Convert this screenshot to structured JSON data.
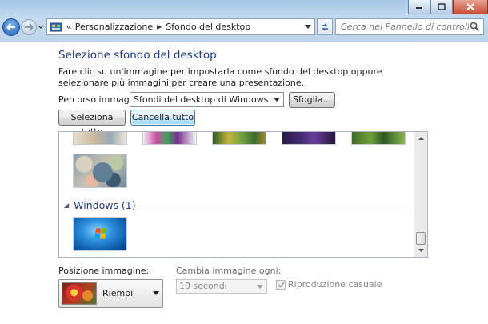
{
  "window": {
    "controls": [
      "minimize-icon",
      "maximize-icon",
      "close-icon"
    ]
  },
  "nav": {
    "breadcrumb_overflow": "«",
    "breadcrumbs": [
      "Personalizzazione",
      "Sfondo del desktop"
    ]
  },
  "search": {
    "placeholder": "Cerca nel Pannello di controllo"
  },
  "page": {
    "title": "Selezione sfondo del desktop",
    "description": "Fare clic su un'immagine per impostarla come sfondo del desktop oppure selezionare più immagini per creare una presentazione."
  },
  "picture_location": {
    "label": "Percorso immagine:",
    "selected": "Sfondi del desktop di Windows",
    "browse_label": "Sfoglia..."
  },
  "selection_buttons": {
    "select_all": "Seleziona tutto",
    "clear_all": "Cancella tutto"
  },
  "gallery": {
    "group_title": "Windows (1)"
  },
  "picture_position": {
    "label": "Posizione immagine:",
    "selected": "Riempi"
  },
  "change_interval": {
    "label": "Cambia immagine ogni:",
    "selected": "10 secondi"
  },
  "shuffle": {
    "label": "Riproduzione casuale",
    "checked": true
  },
  "colors": {
    "title_blue": "#1e3a8a",
    "frame_blue": "#bcd3ea"
  }
}
